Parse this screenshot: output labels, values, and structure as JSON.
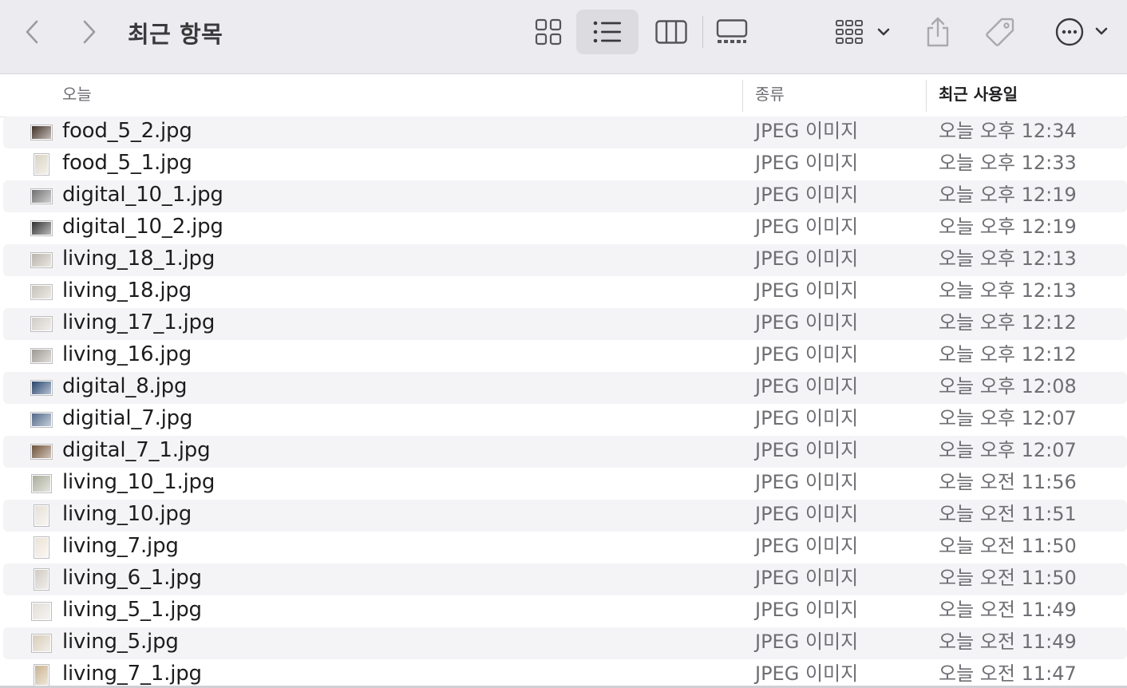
{
  "window": {
    "title": "최근 항목"
  },
  "toolbar": {
    "icons": [
      "chevron-left-icon",
      "chevron-right-icon",
      "grid-view-icon",
      "list-view-icon",
      "column-view-icon",
      "gallery-view-icon",
      "group-icon",
      "share-icon",
      "tag-icon",
      "more-icon"
    ],
    "active_view": "list"
  },
  "columns": {
    "name": "오늘",
    "kind": "종류",
    "date": "최근 사용일"
  },
  "files": [
    {
      "name": "food_5_2.jpg",
      "kind": "JPEG 이미지",
      "date": "오늘 오후 12:34",
      "thumb": "landscape",
      "tone": "#3b2a1e"
    },
    {
      "name": "food_5_1.jpg",
      "kind": "JPEG 이미지",
      "date": "오늘 오후 12:33",
      "thumb": "portrait",
      "tone": "#d9d2c0"
    },
    {
      "name": "digital_10_1.jpg",
      "kind": "JPEG 이미지",
      "date": "오늘 오후 12:19",
      "thumb": "landscape",
      "tone": "#6a6a6a"
    },
    {
      "name": "digital_10_2.jpg",
      "kind": "JPEG 이미지",
      "date": "오늘 오후 12:19",
      "thumb": "landscape",
      "tone": "#2a2a2a"
    },
    {
      "name": "living_18_1.jpg",
      "kind": "JPEG 이미지",
      "date": "오늘 오후 12:13",
      "thumb": "landscape",
      "tone": "#b8b2a6"
    },
    {
      "name": "living_18.jpg",
      "kind": "JPEG 이미지",
      "date": "오늘 오후 12:13",
      "thumb": "landscape",
      "tone": "#c4bfb4"
    },
    {
      "name": "living_17_1.jpg",
      "kind": "JPEG 이미지",
      "date": "오늘 오후 12:12",
      "thumb": "landscape",
      "tone": "#cfcac2"
    },
    {
      "name": "living_16.jpg",
      "kind": "JPEG 이미지",
      "date": "오늘 오후 12:12",
      "thumb": "landscape",
      "tone": "#9a958d"
    },
    {
      "name": "digital_8.jpg",
      "kind": "JPEG 이미지",
      "date": "오늘 오후 12:08",
      "thumb": "landscape",
      "tone": "#1f3f6a"
    },
    {
      "name": "digitial_7.jpg",
      "kind": "JPEG 이미지",
      "date": "오늘 오후 12:07",
      "thumb": "landscape",
      "tone": "#4a6486"
    },
    {
      "name": "digital_7_1.jpg",
      "kind": "JPEG 이미지",
      "date": "오늘 오후 12:07",
      "thumb": "landscape",
      "tone": "#6b4a2e"
    },
    {
      "name": "living_10_1.jpg",
      "kind": "JPEG 이미지",
      "date": "오늘 오전 11:56",
      "thumb": "square",
      "tone": "#a8aa98"
    },
    {
      "name": "living_10.jpg",
      "kind": "JPEG 이미지",
      "date": "오늘 오전 11:51",
      "thumb": "portrait",
      "tone": "#e6dfd6"
    },
    {
      "name": "living_7.jpg",
      "kind": "JPEG 이미지",
      "date": "오늘 오전 11:50",
      "thumb": "portrait",
      "tone": "#ece2d4"
    },
    {
      "name": "living_6_1.jpg",
      "kind": "JPEG 이미지",
      "date": "오늘 오전 11:50",
      "thumb": "portrait",
      "tone": "#cfc9c0"
    },
    {
      "name": "living_5_1.jpg",
      "kind": "JPEG 이미지",
      "date": "오늘 오전 11:49",
      "thumb": "square",
      "tone": "#e1ddd6"
    },
    {
      "name": "living_5.jpg",
      "kind": "JPEG 이미지",
      "date": "오늘 오전 11:49",
      "thumb": "square",
      "tone": "#d6cbb6"
    },
    {
      "name": "living_7_1.jpg",
      "kind": "JPEG 이미지",
      "date": "오늘 오전 11:47",
      "thumb": "portrait",
      "tone": "#c8b08a"
    }
  ]
}
